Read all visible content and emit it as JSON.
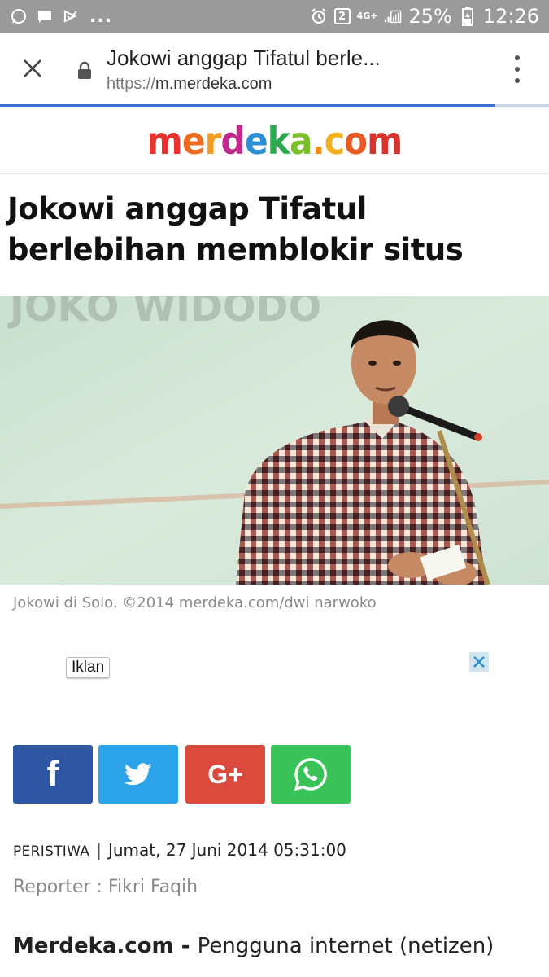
{
  "status_bar": {
    "badge": "2",
    "network": "4G+",
    "battery": "25%",
    "time": "12:26",
    "dots": "..."
  },
  "toolbar": {
    "title": "Jokowi anggap Tifatul berle...",
    "url_scheme": "https://",
    "url_host": "m.merdeka.com",
    "load_progress": 0.9
  },
  "site": {
    "logo_letters": [
      "m",
      "e",
      "r",
      "d",
      "e",
      "k",
      "a",
      ".",
      "c",
      "o",
      "m"
    ],
    "logo_colors": [
      "#e8322f",
      "#ef6b22",
      "#f39c1e",
      "#c02a8a",
      "#2b8fd6",
      "#2ba94f",
      "#7bbf2a",
      "#f08a1d",
      "#f2b01e",
      "#e85a24",
      "#d9332c"
    ]
  },
  "article": {
    "headline": "Jokowi anggap Tifatul berlebihan memblokir situs",
    "caption": "Jokowi di Solo. ©2014 merdeka.com/dwi narwoko",
    "category": "PERISTIWA",
    "separator": "|",
    "datetime": "Jumat, 27 Juni 2014 05:31:00",
    "reporter": "Reporter : Fikri Faqih",
    "lead_source": "Merdeka.com",
    "lead_dash": " - ",
    "lead_text": "Pengguna internet (netizen)"
  },
  "photo": {
    "backdrop_text": "JOKO WIDODO"
  },
  "ad": {
    "label": "Iklan"
  },
  "share": {
    "facebook_glyph": "f",
    "googleplus_glyph": "G+",
    "icons": [
      "facebook-icon",
      "twitter-icon",
      "google-plus-icon",
      "whatsapp-icon"
    ]
  }
}
